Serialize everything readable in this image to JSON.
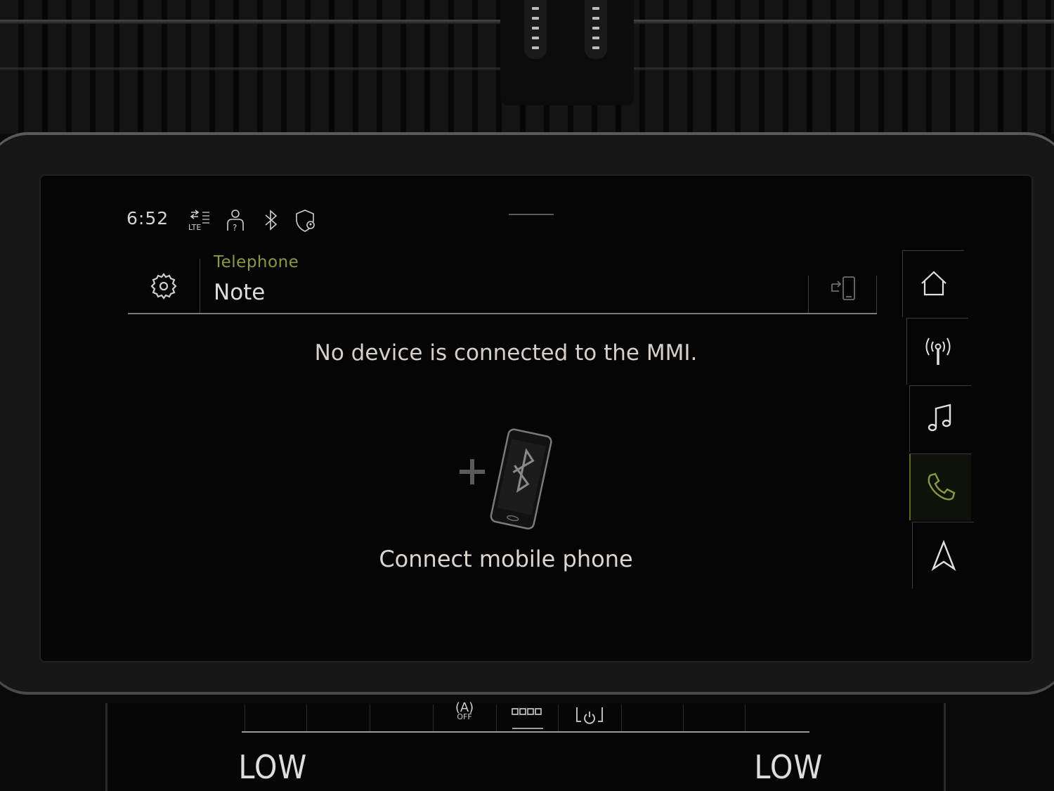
{
  "status_bar": {
    "time": "6:52",
    "icons": [
      "lte-signal-icon",
      "driver-profile-icon",
      "bluetooth-icon",
      "privacy-location-icon"
    ]
  },
  "header": {
    "category": "Telephone",
    "title": "Note",
    "settings_icon": "gear-icon",
    "device_switch_icon": "phone-transfer-icon"
  },
  "main": {
    "message": "No device is connected to the MMI.",
    "connect_label": "Connect mobile phone"
  },
  "nav_rail": {
    "items": [
      {
        "name": "home",
        "icon": "home-icon",
        "active": false
      },
      {
        "name": "radio",
        "icon": "radio-antenna-icon",
        "active": false
      },
      {
        "name": "media",
        "icon": "music-note-icon",
        "active": false
      },
      {
        "name": "telephone",
        "icon": "phone-icon",
        "active": true
      },
      {
        "name": "navigation",
        "icon": "navigation-arrow-icon",
        "active": false
      }
    ]
  },
  "climate": {
    "left_temp": "LOW",
    "right_temp": "LOW",
    "auto_off_label": "OFF",
    "auto_off_icon_text": "(A)"
  },
  "colors": {
    "accent": "#8a9a3a",
    "text": "#dcdcdc",
    "background": "#050505"
  }
}
